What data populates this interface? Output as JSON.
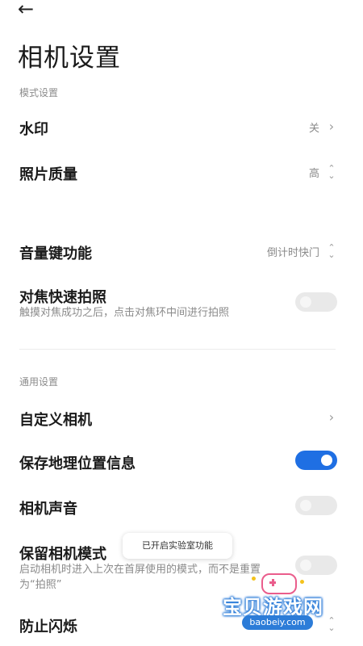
{
  "header": {
    "back_icon": "arrow-left-icon",
    "title": "相机设置"
  },
  "sections": {
    "mode": "模式设置",
    "general": "通用设置"
  },
  "rows": {
    "watermark": {
      "label": "水印",
      "value": "关"
    },
    "photo_quality": {
      "label": "照片质量",
      "value": "高"
    },
    "volume_key": {
      "label": "音量键功能",
      "value": "倒计时快门"
    },
    "focus_shot": {
      "label": "对焦快速拍照",
      "desc": "触摸对焦成功之后，点击对焦环中间进行拍照",
      "enabled": false
    },
    "custom_camera": {
      "label": "自定义相机"
    },
    "save_location": {
      "label": "保存地理位置信息",
      "enabled": true
    },
    "camera_sound": {
      "label": "相机声音",
      "enabled": false
    },
    "keep_mode": {
      "label": "保留相机模式",
      "desc": "启动相机时进入上次在首屏使用的模式，而不是重置为“拍照”",
      "enabled": false
    },
    "anti_flicker": {
      "label": "防止闪烁"
    }
  },
  "toast": "已开启实验室功能",
  "watermark_logo": {
    "text": "宝贝游戏网",
    "url": "baobeiy.com"
  },
  "colors": {
    "accent": "#1f6fe3",
    "toggle_off": "#e9e9e9",
    "secondary_text": "#8a8a8a"
  }
}
